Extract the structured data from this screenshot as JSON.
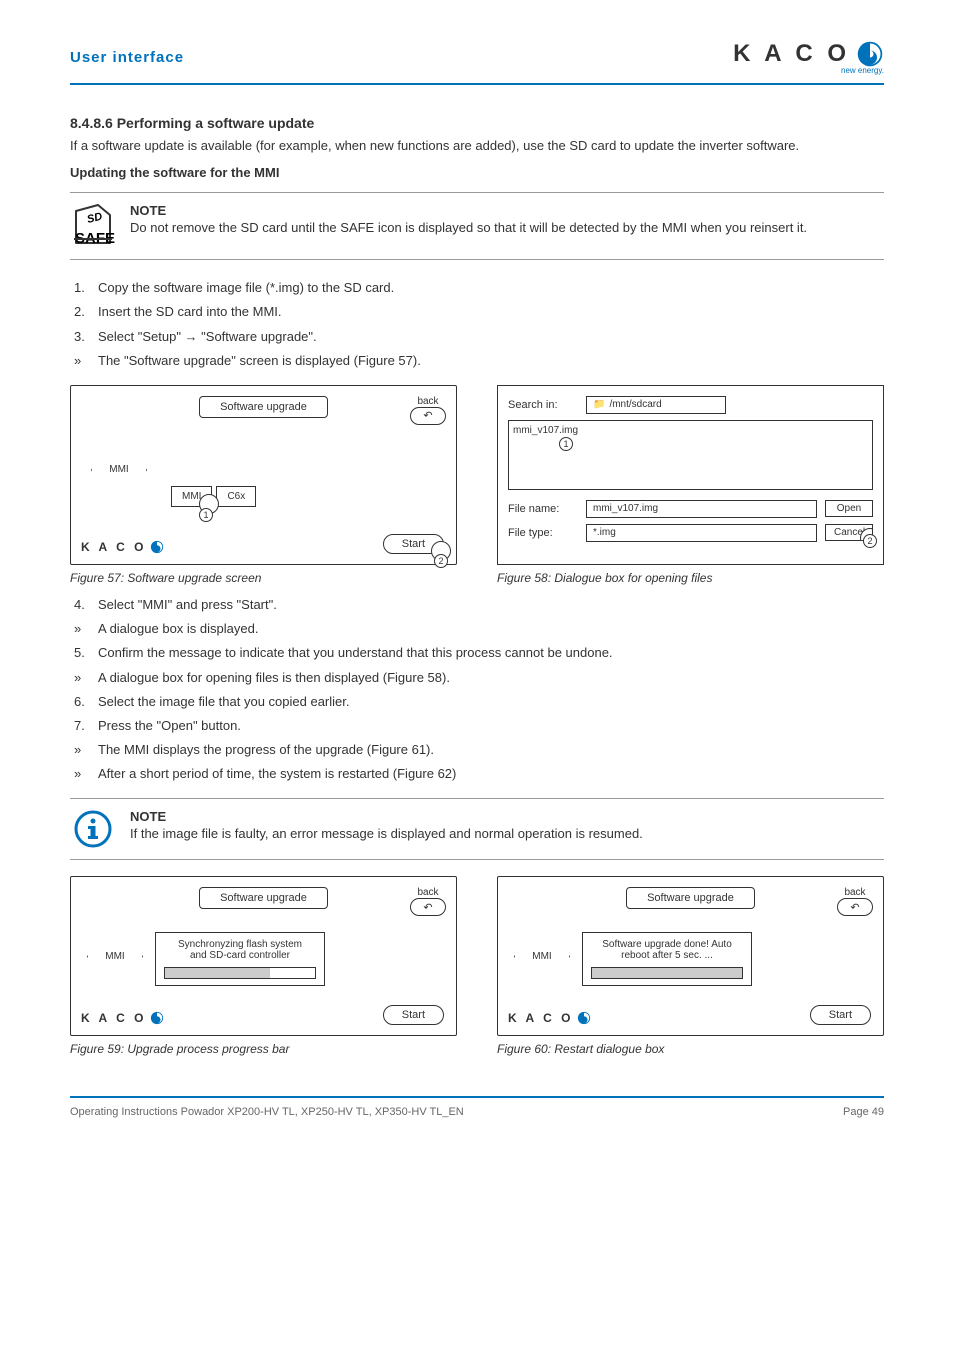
{
  "header": {
    "section": "User interface",
    "logo_text": "K A C O",
    "logo_sub": "new energy."
  },
  "sec": {
    "num_title": "8.4.8.6   Performing a software update",
    "intro": "If a software update is available (for example, when new functions are added), use the SD card to update the inverter software.",
    "sub1": "Updating the software for the MMI"
  },
  "note1": {
    "head": "NOTE",
    "body": "Do not remove the SD card until the SAFE icon is displayed so that it will be detected by the MMI when you reinsert it.",
    "icon_line1": "SD",
    "icon_line2": "SAFE"
  },
  "steps1": [
    {
      "mark": "1.",
      "text": "Copy the software image file (*.img) to the SD card."
    },
    {
      "mark": "2.",
      "text": "Insert the SD card into the MMI."
    },
    {
      "mark": "3.",
      "text": "Select \"Setup\" → \"Software upgrade\"."
    },
    {
      "mark": "»",
      "text": "The \"Software upgrade\" screen is displayed (Figure 57)."
    }
  ],
  "fig57": {
    "title": "Software upgrade",
    "back": "back",
    "mmi": "MMI",
    "c6x": "C6x",
    "start": "Start",
    "logo": "K A C O",
    "cap": "Figure 57: Software upgrade screen",
    "m1": "1",
    "m2": "2"
  },
  "fig58": {
    "search_lbl": "Search in:",
    "search_val": "/mnt/sdcard",
    "list_item": "mmi_v107.img",
    "fname_lbl": "File name:",
    "fname_val": "mmi_v107.img",
    "ftype_lbl": "File type:",
    "ftype_val": "*.img",
    "open": "Open",
    "cancel": "Cancel",
    "cap": "Figure 58: Dialogue box for opening files",
    "m1": "1",
    "m2": "2"
  },
  "steps2": [
    {
      "mark": "4.",
      "text": "Select \"MMI\" and press \"Start\"."
    },
    {
      "mark": "»",
      "text": "A dialogue box is displayed."
    },
    {
      "mark": "5.",
      "text": "Confirm the message to indicate that you understand that this process cannot be undone."
    },
    {
      "mark": "»",
      "text": "A dialogue box for opening files is then displayed (Figure 58)."
    },
    {
      "mark": "6.",
      "text": "Select the image file that you copied earlier."
    },
    {
      "mark": "7.",
      "text": "Press the \"Open\" button."
    },
    {
      "mark": "»",
      "text": "The MMI displays the progress of the upgrade (Figure 61)."
    },
    {
      "mark": "»",
      "text": "After a short period of time, the system is restarted (Figure 62)"
    }
  ],
  "note2": {
    "head": "NOTE",
    "body": "If the image file is faulty, an error message is displayed and normal operation is resumed."
  },
  "fig59": {
    "title": "Software upgrade",
    "back": "back",
    "mmi": "MMI",
    "msg_l1": "Synchronyzing flash system",
    "msg_l2": "and SD-card controller",
    "start": "Start",
    "logo": "K A C O",
    "cap": "Figure 59: Upgrade process progress bar"
  },
  "fig60": {
    "title": "Software upgrade",
    "back": "back",
    "mmi": "MMI",
    "msg_l1": "Software upgrade done! Auto",
    "msg_l2": "reboot after 5 sec. ...",
    "start": "Start",
    "logo": "K A C O",
    "cap": "Figure 60: Restart dialogue box"
  },
  "footer": {
    "left": "Operating Instructions Powador XP200-HV TL, XP250-HV TL, XP350-HV TL_EN",
    "right": "Page 49"
  }
}
